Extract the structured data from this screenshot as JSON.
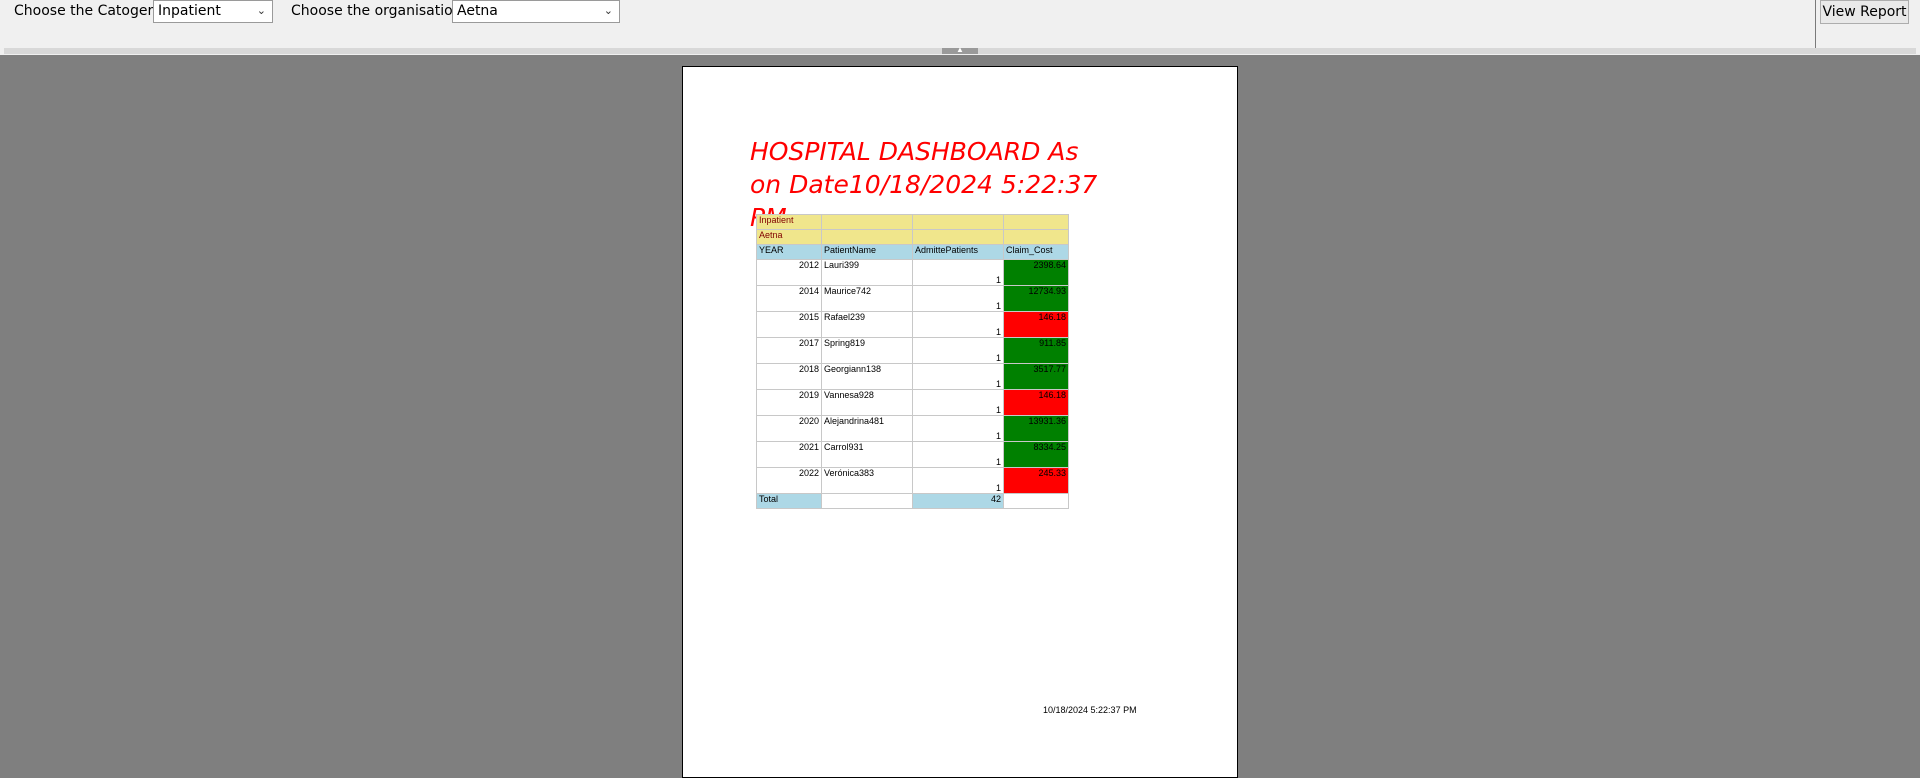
{
  "toolbar": {
    "category_label": "Choose the Catogery",
    "category_value": "Inpatient",
    "org_label": "Choose the organisation",
    "org_value": "Aetna",
    "view_report_label": "View Report"
  },
  "report": {
    "title": "HOSPITAL DASHBOARD As on Date10/18/2024 5:22:37 PM",
    "filter_category": "Inpatient",
    "filter_org": "Aetna",
    "columns": [
      "YEAR",
      "PatientName",
      "AdmittePatients",
      "Claim_Cost"
    ],
    "rows": [
      {
        "year": "2012",
        "name": "Lauri399",
        "admitted": "1",
        "cost": "2398.64",
        "color": "#008000"
      },
      {
        "year": "2014",
        "name": "Maurice742",
        "admitted": "1",
        "cost": "12734.93",
        "color": "#008000"
      },
      {
        "year": "2015",
        "name": "Rafael239",
        "admitted": "1",
        "cost": "146.18",
        "color": "#ff0000"
      },
      {
        "year": "2017",
        "name": "Spring819",
        "admitted": "1",
        "cost": "911.85",
        "color": "#008000"
      },
      {
        "year": "2018",
        "name": "Georgiann138",
        "admitted": "1",
        "cost": "3517.77",
        "color": "#008000"
      },
      {
        "year": "2019",
        "name": "Vannesa928",
        "admitted": "1",
        "cost": "146.18",
        "color": "#ff0000"
      },
      {
        "year": "2020",
        "name": "Alejandrina481",
        "admitted": "1",
        "cost": "13931.36",
        "color": "#008000"
      },
      {
        "year": "2021",
        "name": "Carrol931",
        "admitted": "1",
        "cost": "8334.25",
        "color": "#008000"
      },
      {
        "year": "2022",
        "name": "Verónica383",
        "admitted": "1",
        "cost": "245.33",
        "color": "#ff0000"
      }
    ],
    "total_label": "Total",
    "total_admitted": "42",
    "footer_timestamp": "10/18/2024 5:22:37 PM"
  }
}
